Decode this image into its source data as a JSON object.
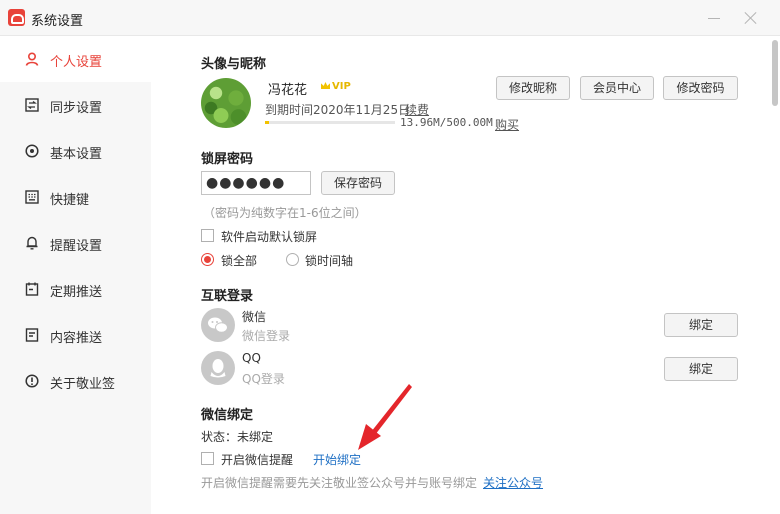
{
  "window": {
    "title": "系统设置",
    "icons": {
      "app": "cloud-logo-icon",
      "minimize": "minimize-icon",
      "close": "close-icon"
    },
    "accent_color": "#e8433a"
  },
  "sidebar": {
    "items": [
      {
        "label": "个人设置",
        "icon": "user-icon",
        "active": true
      },
      {
        "label": "同步设置",
        "icon": "sync-icon",
        "active": false
      },
      {
        "label": "基本设置",
        "icon": "gear-icon",
        "active": false
      },
      {
        "label": "快捷键",
        "icon": "keyboard-icon",
        "active": false
      },
      {
        "label": "提醒设置",
        "icon": "bell-icon",
        "active": false
      },
      {
        "label": "定期推送",
        "icon": "calendar-icon",
        "active": false
      },
      {
        "label": "内容推送",
        "icon": "document-icon",
        "active": false
      },
      {
        "label": "关于敬业签",
        "icon": "info-icon",
        "active": false
      }
    ]
  },
  "profile": {
    "section_title": "头像与昵称",
    "username": "冯花花",
    "vip_label": "VIP",
    "expire_text": "到期时间2020年11月25日",
    "renew_label": "续费",
    "storage_text": "13.96M/500.00M",
    "storage_fraction": 0.028,
    "buy_label": "购买",
    "buttons": {
      "edit_nickname": "修改昵称",
      "member_center": "会员中心",
      "change_password": "修改密码"
    }
  },
  "lock_screen": {
    "section_title": "锁屏密码",
    "password_value": "●●●●●●",
    "save_label": "保存密码",
    "hint": "（密码为纯数字在1-6位之间）",
    "auto_lock_label": "软件启动默认锁屏",
    "auto_lock_checked": false,
    "mode_all_label": "锁全部",
    "mode_timeline_label": "锁时间轴",
    "selected_mode": "all"
  },
  "social_login": {
    "section_title": "互联登录",
    "accounts": [
      {
        "name": "微信",
        "sub": "微信登录",
        "button": "绑定",
        "icon": "wechat-icon"
      },
      {
        "name": "QQ",
        "sub": "QQ登录",
        "button": "绑定",
        "icon": "qq-icon"
      }
    ]
  },
  "wechat_bind": {
    "section_title": "微信绑定",
    "status_text": "状态：未绑定",
    "reminder_label": "开启微信提醒",
    "reminder_checked": false,
    "start_bind_label": "开始绑定",
    "note": "开启微信提醒需要先关注敬业签公众号并与账号绑定",
    "follow_label": "关注公众号"
  }
}
